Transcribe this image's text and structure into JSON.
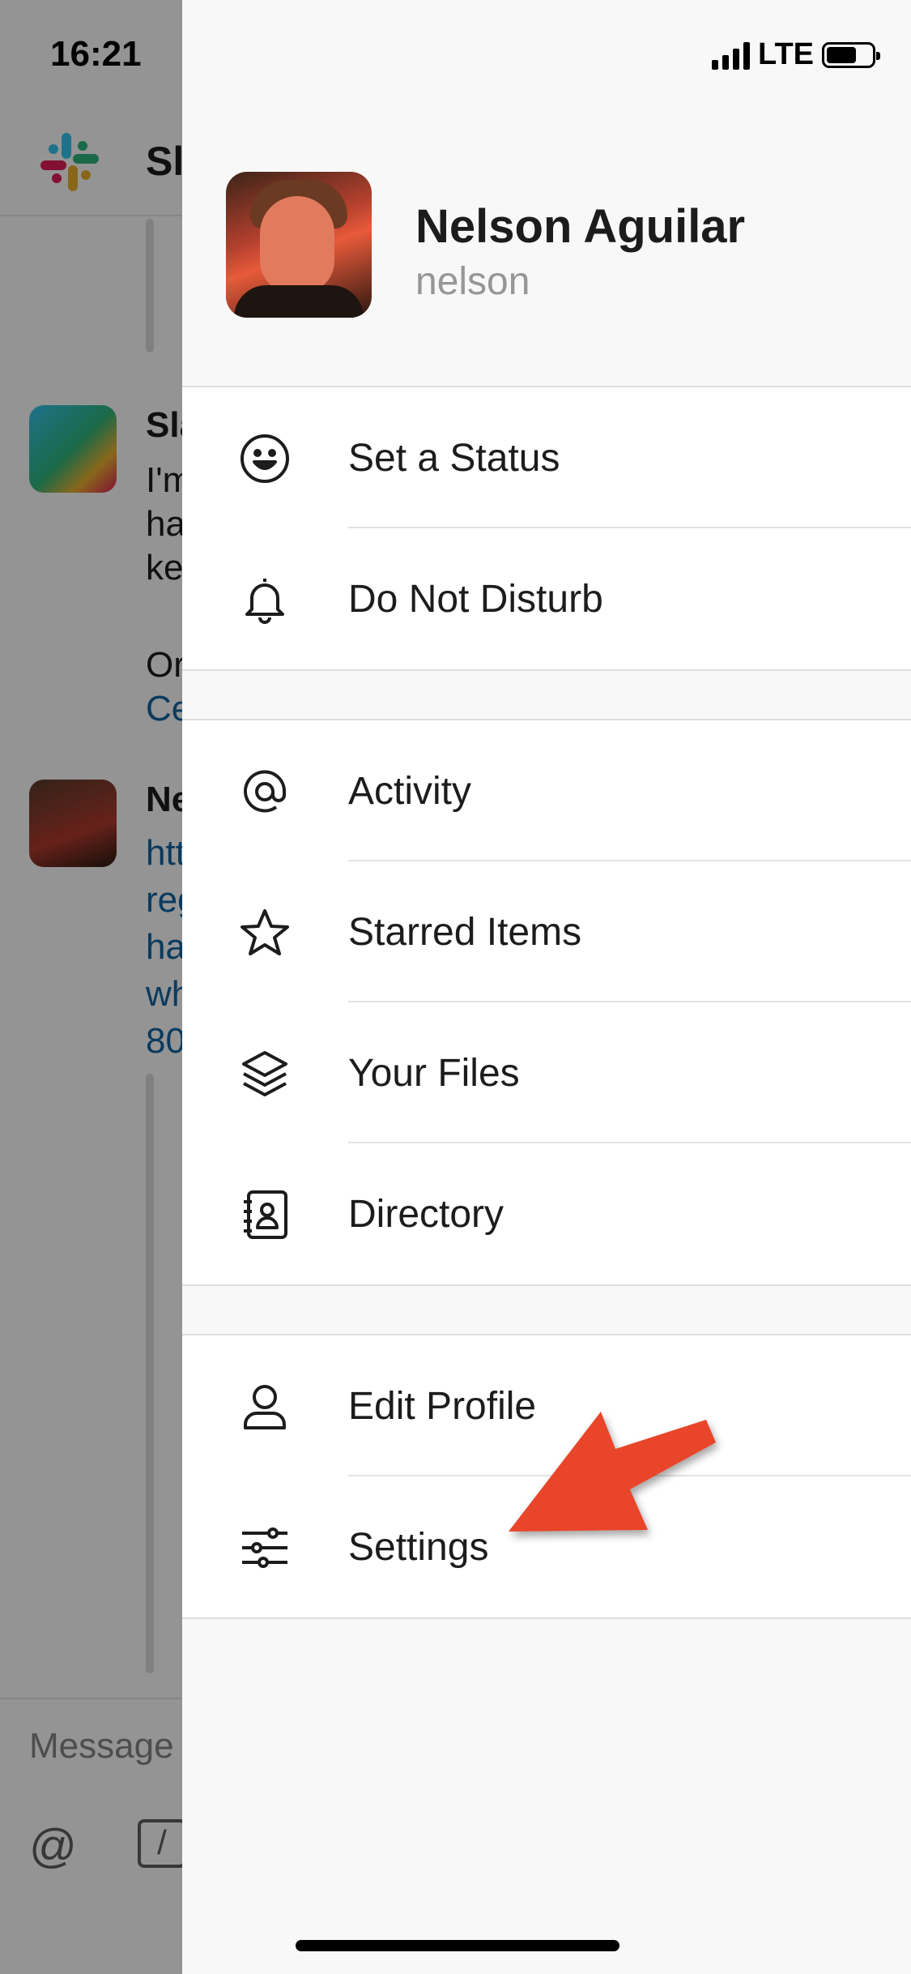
{
  "status_bar": {
    "time": "16:21",
    "network": "LTE"
  },
  "background": {
    "channel_title": "Sl",
    "message1_name": "Sla",
    "message1_lines": [
      "I'm",
      "ha",
      "ke",
      "",
      "Or",
      "Ce"
    ],
    "message2_name": "Ne",
    "message2_lines": [
      "htt",
      "reg",
      "ha",
      "wh",
      "80"
    ],
    "composer_placeholder": "Message",
    "composer_at": "@",
    "composer_slash": "/"
  },
  "profile": {
    "name": "Nelson Aguilar",
    "handle": "nelson"
  },
  "menu_groups": [
    [
      {
        "label": "Set a Status",
        "icon": "smiley-icon"
      },
      {
        "label": "Do Not Disturb",
        "icon": "bell-icon"
      }
    ],
    [
      {
        "label": "Activity",
        "icon": "at-icon"
      },
      {
        "label": "Starred Items",
        "icon": "star-icon"
      },
      {
        "label": "Your Files",
        "icon": "layers-icon"
      },
      {
        "label": "Directory",
        "icon": "directory-icon"
      }
    ],
    [
      {
        "label": "Edit Profile",
        "icon": "person-icon"
      },
      {
        "label": "Settings",
        "icon": "sliders-icon"
      }
    ]
  ],
  "colors": {
    "annotation_arrow": "#e8442a",
    "link": "#1264a3",
    "text": "#1d1c1d",
    "muted": "#969696"
  }
}
